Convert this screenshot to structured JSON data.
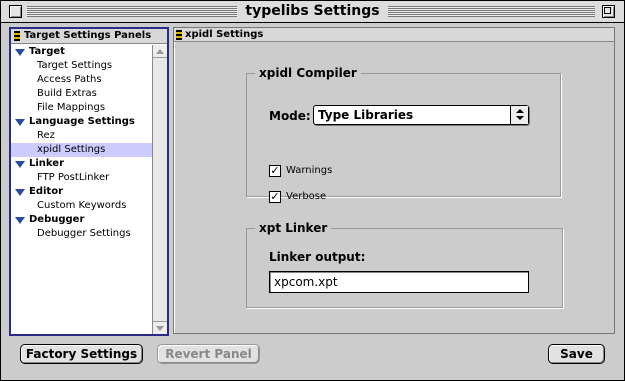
{
  "window": {
    "title": "typelibs Settings"
  },
  "sidebar": {
    "header": "Target Settings Panels",
    "categories": [
      {
        "label": "Target",
        "items": [
          "Target Settings",
          "Access Paths",
          "Build Extras",
          "File Mappings"
        ]
      },
      {
        "label": "Language Settings",
        "items": [
          "Rez",
          "xpidl Settings"
        ]
      },
      {
        "label": "Linker",
        "items": [
          "FTP PostLinker"
        ]
      },
      {
        "label": "Editor",
        "items": [
          "Custom Keywords"
        ]
      },
      {
        "label": "Debugger",
        "items": [
          "Debugger Settings"
        ]
      }
    ],
    "selected_item": "xpidl Settings"
  },
  "panel": {
    "header": "xpidl Settings",
    "compiler_group": {
      "title": "xpidl Compiler",
      "mode_label": "Mode:",
      "mode_value": "Type Libraries",
      "warnings_label": "Warnings",
      "warnings_checked": true,
      "verbose_label": "Verbose",
      "verbose_checked": true
    },
    "linker_group": {
      "title": "xpt Linker",
      "output_label": "Linker output:",
      "output_value": "xpcom.xpt"
    }
  },
  "buttons": {
    "factory": "Factory Settings",
    "revert": "Revert Panel",
    "save": "Save"
  },
  "colors": {
    "selection": "#ccccff",
    "list_border": "#2a2a8a",
    "disclosure_triangle": "#2a4aa8"
  }
}
